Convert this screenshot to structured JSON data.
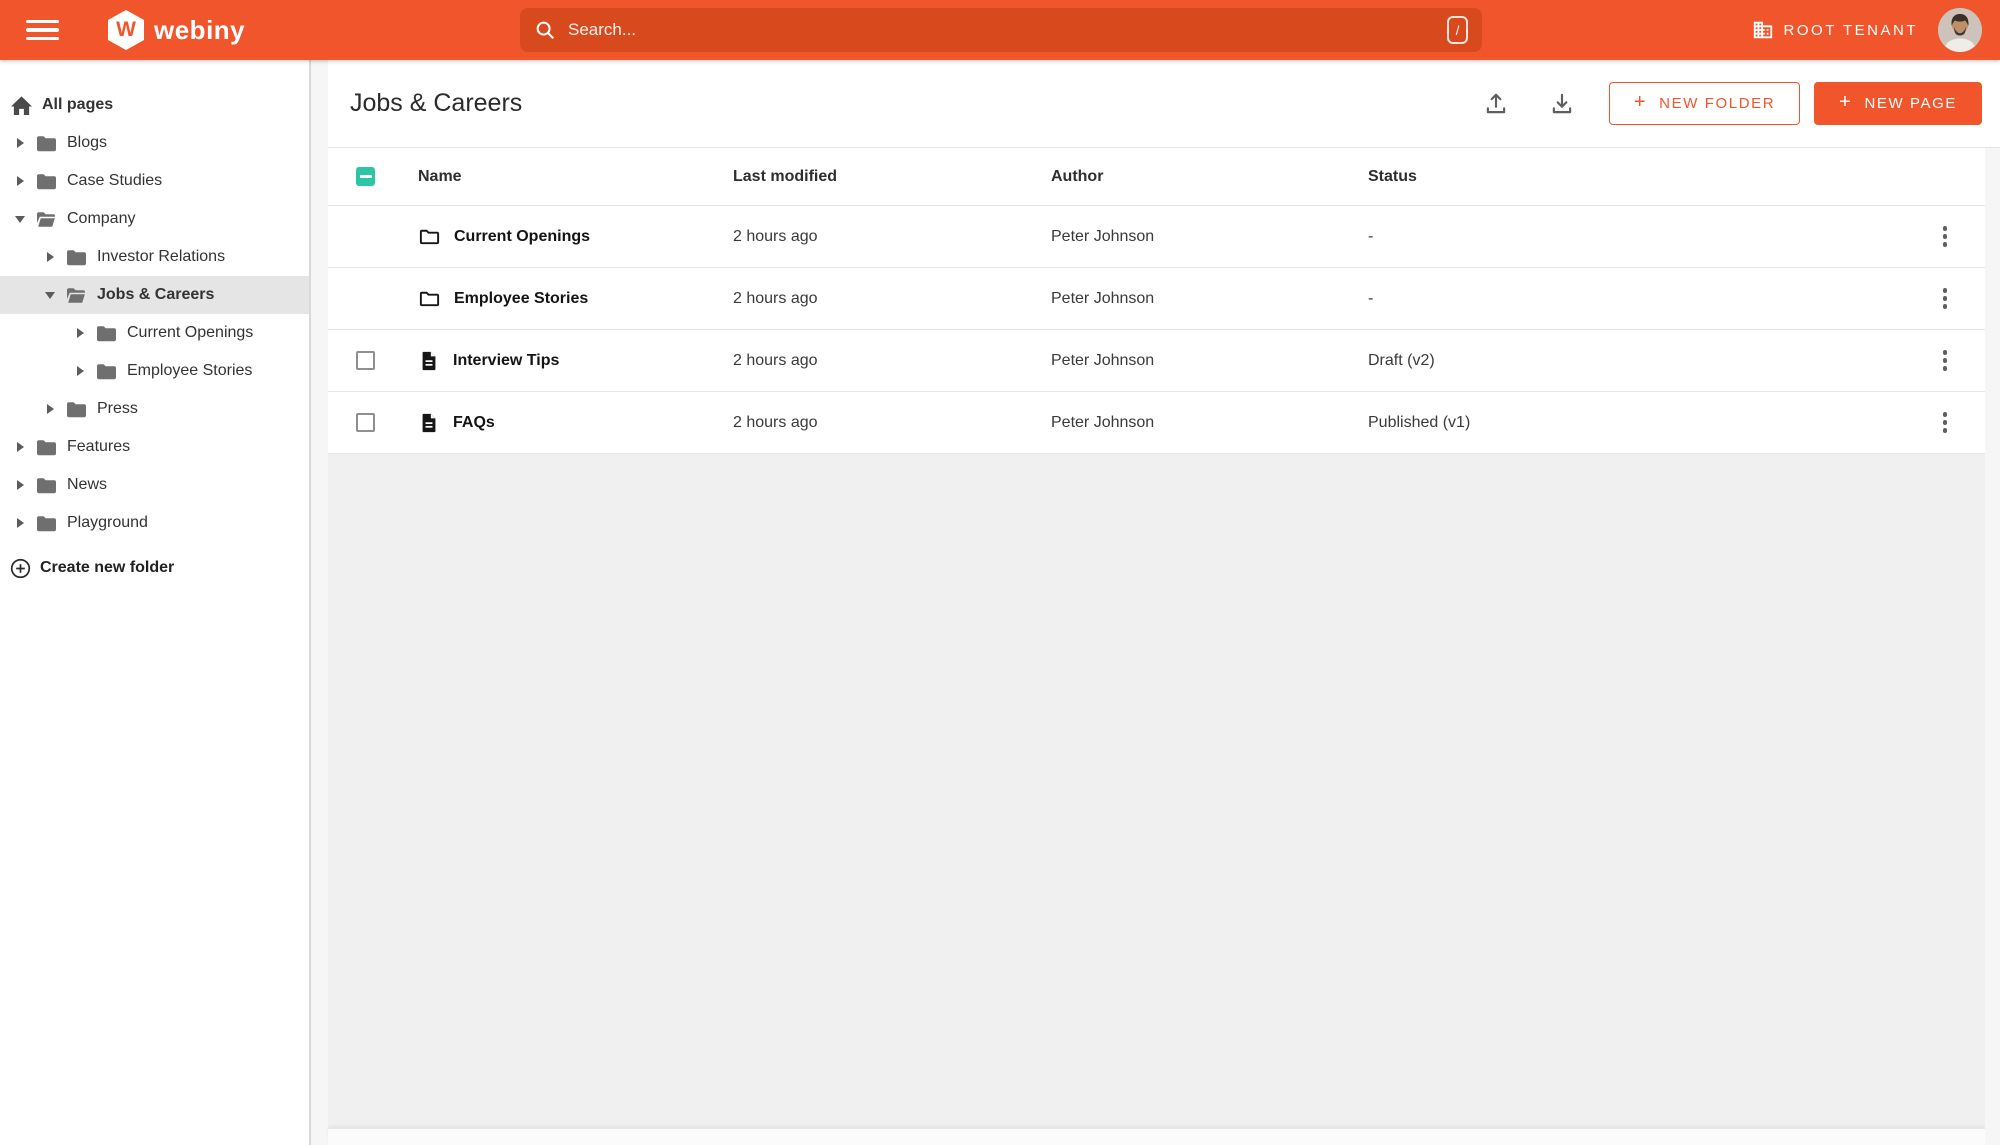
{
  "topbar": {
    "brand": "webiny",
    "logo_letter": "W",
    "search": {
      "placeholder": "Search...",
      "shortcut": "/"
    },
    "tenant": "ROOT TENANT"
  },
  "sidebar": {
    "root_label": "All pages",
    "create_folder_label": "Create new folder",
    "items": [
      {
        "label": "Blogs",
        "depth": 0,
        "state": "collapsed",
        "selected": false
      },
      {
        "label": "Case Studies",
        "depth": 0,
        "state": "collapsed",
        "selected": false
      },
      {
        "label": "Company",
        "depth": 0,
        "state": "expanded",
        "selected": false
      },
      {
        "label": "Investor Relations",
        "depth": 1,
        "state": "collapsed",
        "selected": false
      },
      {
        "label": "Jobs & Careers",
        "depth": 1,
        "state": "expanded",
        "selected": true
      },
      {
        "label": "Current Openings",
        "depth": 2,
        "state": "collapsed",
        "selected": false
      },
      {
        "label": "Employee Stories",
        "depth": 2,
        "state": "collapsed",
        "selected": false
      },
      {
        "label": "Press",
        "depth": 1,
        "state": "collapsed",
        "selected": false
      },
      {
        "label": "Features",
        "depth": 0,
        "state": "collapsed",
        "selected": false
      },
      {
        "label": "News",
        "depth": 0,
        "state": "collapsed",
        "selected": false
      },
      {
        "label": "Playground",
        "depth": 0,
        "state": "collapsed",
        "selected": false
      }
    ]
  },
  "main": {
    "title": "Jobs & Careers",
    "actions": {
      "new_folder": "NEW FOLDER",
      "new_page": "NEW PAGE",
      "plus": "+"
    },
    "table": {
      "headers": {
        "name": "Name",
        "modified": "Last modified",
        "author": "Author",
        "status": "Status"
      },
      "rows": [
        {
          "type": "folder",
          "name": "Current Openings",
          "modified": "2 hours ago",
          "author": "Peter Johnson",
          "status": "-",
          "has_checkbox": false
        },
        {
          "type": "folder",
          "name": "Employee Stories",
          "modified": "2 hours ago",
          "author": "Peter Johnson",
          "status": "-",
          "has_checkbox": false
        },
        {
          "type": "page",
          "name": "Interview Tips",
          "modified": "2 hours ago",
          "author": "Peter Johnson",
          "status": "Draft (v2)",
          "has_checkbox": true
        },
        {
          "type": "page",
          "name": "FAQs",
          "modified": "2 hours ago",
          "author": "Peter Johnson",
          "status": "Published (v1)",
          "has_checkbox": true
        }
      ]
    }
  },
  "icons": {
    "hamburger": "three-bars",
    "search": "magnifier",
    "shortcut_key": "/",
    "tenant": "building",
    "upload": "arrow-up-from-tray",
    "download": "arrow-down-to-tray",
    "folder_row": "folder-outline",
    "page_row": "document-lines",
    "kebab": "three-dots-vertical",
    "home": "house",
    "create_folder": "circle-plus",
    "chevron_collapsed": "triangle-right",
    "chevron_expanded": "triangle-down"
  },
  "colors": {
    "accent": "#f0552b",
    "search_field": "#d84a1e",
    "select_teal": "#2cc6a5",
    "selected_row_bg": "#e5e5e5"
  }
}
